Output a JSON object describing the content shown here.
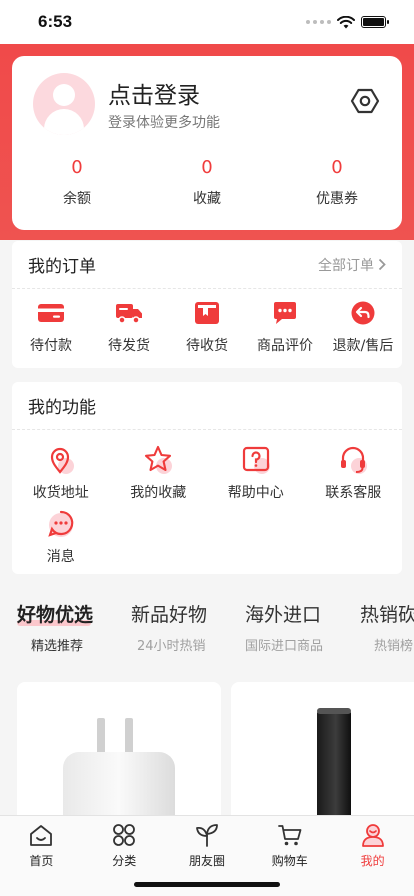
{
  "status_bar": {
    "time": "6:53"
  },
  "profile": {
    "title": "点击登录",
    "subtitle": "登录体验更多功能",
    "stats": [
      {
        "value": "0",
        "label": "余额"
      },
      {
        "value": "0",
        "label": "收藏"
      },
      {
        "value": "0",
        "label": "优惠券"
      }
    ]
  },
  "orders": {
    "title": "我的订单",
    "more": "全部订单",
    "items": [
      {
        "label": "待付款",
        "icon": "card-icon"
      },
      {
        "label": "待发货",
        "icon": "truck-icon"
      },
      {
        "label": "待收货",
        "icon": "package-icon"
      },
      {
        "label": "商品评价",
        "icon": "comment-icon"
      },
      {
        "label": "退款/售后",
        "icon": "return-icon"
      }
    ]
  },
  "functions": {
    "title": "我的功能",
    "items": [
      {
        "label": "收货地址",
        "icon": "location-icon"
      },
      {
        "label": "我的收藏",
        "icon": "star-icon"
      },
      {
        "label": "帮助中心",
        "icon": "help-icon"
      },
      {
        "label": "联系客服",
        "icon": "headset-icon"
      },
      {
        "label": "消息",
        "icon": "message-icon"
      }
    ]
  },
  "tabs": [
    {
      "title": "好物优选",
      "sub": "精选推荐"
    },
    {
      "title": "新品好物",
      "sub": "24小时热销"
    },
    {
      "title": "海外进口",
      "sub": "国际进口商品"
    },
    {
      "title": "热销砍",
      "sub": "热销榜"
    }
  ],
  "tabbar": [
    {
      "label": "首页",
      "icon": "home-icon"
    },
    {
      "label": "分类",
      "icon": "category-icon"
    },
    {
      "label": "朋友圈",
      "icon": "sprout-icon"
    },
    {
      "label": "购物车",
      "icon": "cart-icon"
    },
    {
      "label": "我的",
      "icon": "user-icon"
    }
  ],
  "colors": {
    "accent": "#ef3b3b",
    "header": "#f04a4a",
    "avatar_bg": "#fcd9de"
  }
}
